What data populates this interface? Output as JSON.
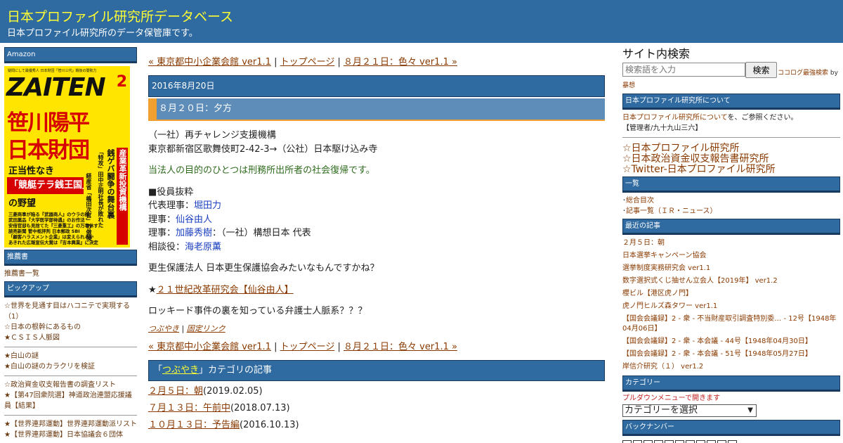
{
  "header": {
    "title": "日本プロファイル研究所データベース",
    "description": "日本プロファイル研究所のデータ保管庫です。"
  },
  "left": {
    "amazon_head": "Amazon",
    "cover": {
      "topline": "疑問にして最優秀人  日本財団「笹川三代」戦後の闇勢力",
      "logo": "ZAITEN",
      "issue": "2",
      "headline1": "笹川陽平",
      "headline2": "日本財団",
      "sub1": "正当性なき",
      "band": "「競艇テラ銭王国」",
      "sub2": "の野望",
      "vertical1": "産業革新投資機構",
      "vertical2": "銭ゲバ闘争の舞台裏",
      "vertical3": "「特攻」田中正明社長が敗れた",
      "vertical4": "経産省「嶋田次官」の傲慢",
      "small": [
        "三菱商事が陥る『武器商人』のウラの顔",
        "武田薬品『大学医学部待遇』のお作法",
        "安倍官邸も見捨てた『三菱重工』の万事休す",
        "読売新聞 菅中枢評判 日本郵政 SBI",
        "「顧客ハラスメント企業」は変えられるか",
        "あきれた広報宣伝大賞は『吉本興業』に決定"
      ]
    },
    "recommend_head": "推薦書",
    "recommend_link": "推薦書一覧",
    "pickup_head": "ピックアップ",
    "pickup_group1": [
      "☆世界を見通す目はハコニテで実現する（1）",
      "☆日本の根幹にあるもの",
      "★ＣＳＩＳ人脈図"
    ],
    "pickup_group2": [
      "★白山の謎",
      "★白山の謎のカラクリを検証"
    ],
    "pickup_group3": [
      "☆政治資金収支報告書の調査リスト",
      "★【第47回衆院選】神道政治連盟応援議員【結果】"
    ],
    "pickup_group4": [
      "★【世界連邦運動】世界連邦運動派リスト",
      "★【世界連邦運動】日本協議会６団体"
    ]
  },
  "main": {
    "nav": {
      "prev": "« 東京都中小企業会館 ver1.1",
      "sep1": " | ",
      "top": "トップページ",
      "sep2": " | ",
      "next": "８月２１日：色々 ver1.1 »"
    },
    "date": "2016年8月20日",
    "title": "８月２０日：夕方",
    "lines": {
      "l1": "（一社）再チャレンジ支援機構",
      "l2": "東京都新宿区歌舞伎町2-42-3→（公社）日本駆け込み寺",
      "l3": "当法人の目的のひとつは刑務所出所者の社会復帰です。",
      "l4": "■役員抜粋",
      "l5_label": "代表理事：",
      "l5_name": "堀田力",
      "l6_label": "理事：",
      "l6_name": "仙谷由人",
      "l7_label": "理事：",
      "l7_name": "加藤秀樹",
      "l7_rest": "：（一社）構想日本 代表",
      "l8_label": "相談役：",
      "l8_name": "海老原薫",
      "l9": "更生保護法人 日本更生保護協会みたいなもんですかね？",
      "l10_star": "★",
      "l10_link": "２１世紀改革研究会【仙谷由人】",
      "l11": "ロッキード事件の裏を知っている弁護士人脈系？？？"
    },
    "footer": {
      "category": "つぶやき",
      "sep": " | ",
      "permalink": "固定リンク"
    },
    "category_bar": {
      "pre": "「",
      "link": "つぶやき",
      "post": "」カテゴリの記事"
    },
    "category_items": [
      {
        "title": "２月５日：朝",
        "date": "(2019.02.05)"
      },
      {
        "title": "７月１３日：午前中",
        "date": "(2018.07.13)"
      },
      {
        "title": "１０月１３日：予告編",
        "date": "(2016.10.13)"
      }
    ]
  },
  "right": {
    "search_title": "サイト内検索",
    "search_placeholder": "検索語を入力",
    "search_button": "検索",
    "powered_link": "ココログ最強検索",
    "powered_by": " by",
    "author": "暴想",
    "about_head": "日本プロファイル研究所について",
    "about_link": "日本プロファイル研究所について",
    "about_rest": "を、ご参照ください。",
    "admin": "【管理者/九十九山三六】",
    "big_links": [
      "☆日本プロファイル研究所",
      "☆日本政治資金収支報告書研究所",
      "☆Twitter-日本プロファイル研究所"
    ],
    "list_head": "一覧",
    "list_items": [
      "総合目次",
      "記事一覧（ＩＲ・ニュース）"
    ],
    "recent_head": "最近の記事",
    "recent_items": [
      "２月５日：朝",
      "日本選挙キャンペーン協会",
      "選挙制度実務研究会 ver1.1",
      "数字選択式くじ抽せん立会人【2019年】 ver1.2",
      "櫻ビル【港区虎ノ門】",
      "虎ノ門ヒルズ森タワー ver1.1",
      "【国会会議録】2 - 衆 - 不当財産取引調査特別委… - 12号【1948年04月06日】",
      "【国会会議録】2 - 衆 - 本会議 - 44号【1948年04月30日】",
      "【国会会議録】2 - 衆 - 本会議 - 51号【1948年05月27日】",
      "岸信介研究（１） ver1.2"
    ],
    "category_head": "カテゴリー",
    "category_note": "プルダウンメニューで開きます",
    "category_select": "カテゴリーを選択",
    "backnumber_head": "バックナンバー"
  },
  "colors": {
    "header_bg": "#2f6aa0",
    "title_yellow": "#ffff33",
    "link_brown": "#8a3a00",
    "accent_orange": "#f0a030",
    "red": "#d70000"
  }
}
